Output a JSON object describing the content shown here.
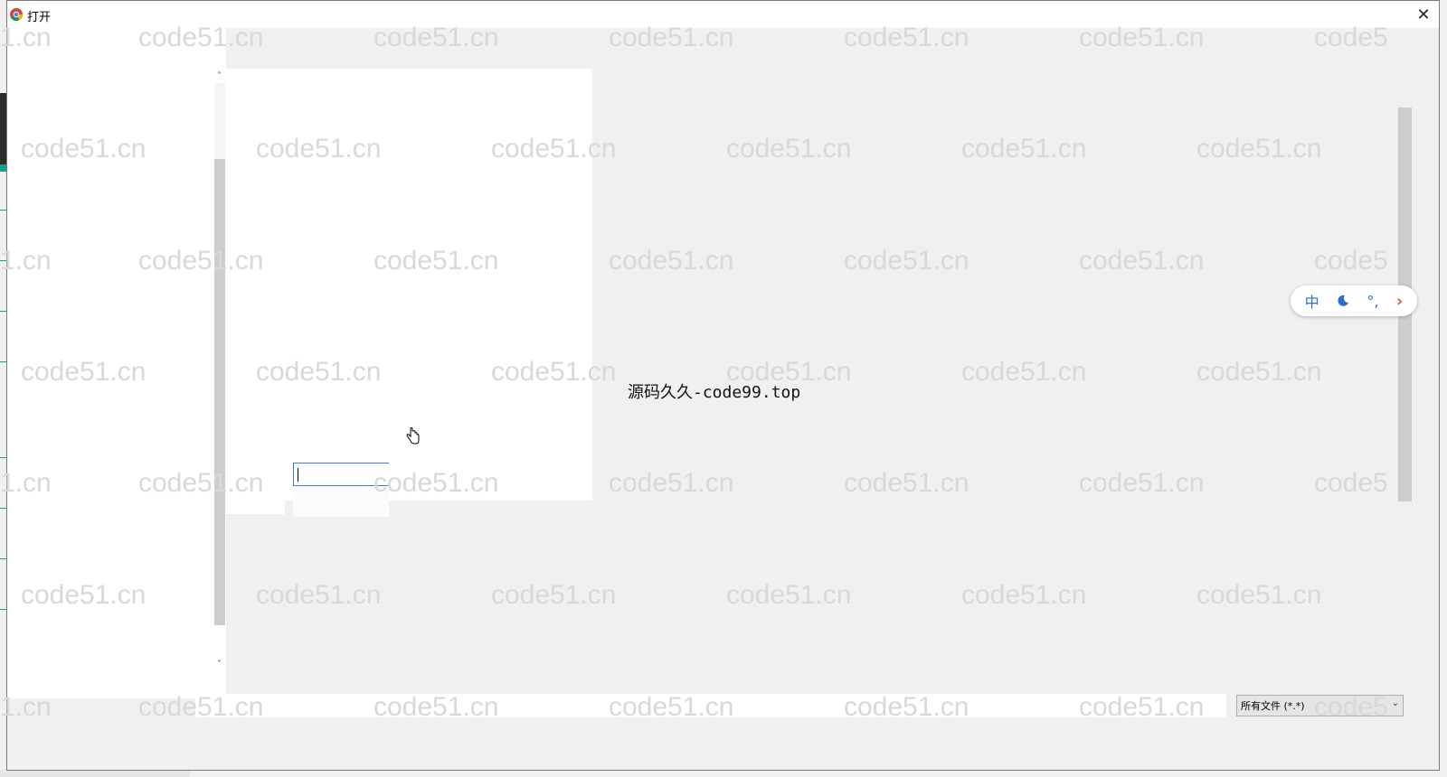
{
  "window": {
    "title": "打开",
    "close_glyph": "✕"
  },
  "nav": {
    "scroll_up_glyph": "˄",
    "scroll_down_glyph": "˅"
  },
  "center_label": "源码久久-code99.top",
  "ime": {
    "lang": "中",
    "mode_icon": "moon-icon",
    "punct": "°,",
    "arrow": "›"
  },
  "file_type": {
    "selected": "所有文件 (*.*)",
    "chevron": "⌄"
  },
  "watermark": {
    "text": "code51.cn",
    "rows": [
      [
        "1.cn",
        "code51.cn",
        "code51.cn",
        "code51.cn",
        "code51.cn",
        "code51.cn",
        "code5"
      ],
      [
        "code51.cn",
        "code51.cn",
        "code51.cn",
        "code51.cn",
        "code51.cn",
        "code51.cn"
      ],
      [
        "1.cn",
        "code51.cn",
        "code51.cn",
        "code51.cn",
        "code51.cn",
        "code51.cn",
        "code5"
      ],
      [
        "code51.cn",
        "code51.cn",
        "code51.cn",
        "code51.cn",
        "code51.cn",
        "code51.cn"
      ],
      [
        "1.cn",
        "code51.cn",
        "code51.cn",
        "code51.cn",
        "code51.cn",
        "code51.cn",
        "code5"
      ],
      [
        "code51.cn",
        "code51.cn",
        "code51.cn",
        "code51.cn",
        "code51.cn",
        "code51.cn"
      ],
      [
        "1.cn",
        "code51.cn",
        "code51.cn",
        "code51.cn",
        "code51.cn",
        "code51.cn",
        "code5"
      ]
    ]
  },
  "colors": {
    "accent": "#3c7bd8",
    "ime_blue": "#2a6fd6",
    "ime_arrow": "#e05a3a",
    "teal": "#1a9e8f"
  }
}
